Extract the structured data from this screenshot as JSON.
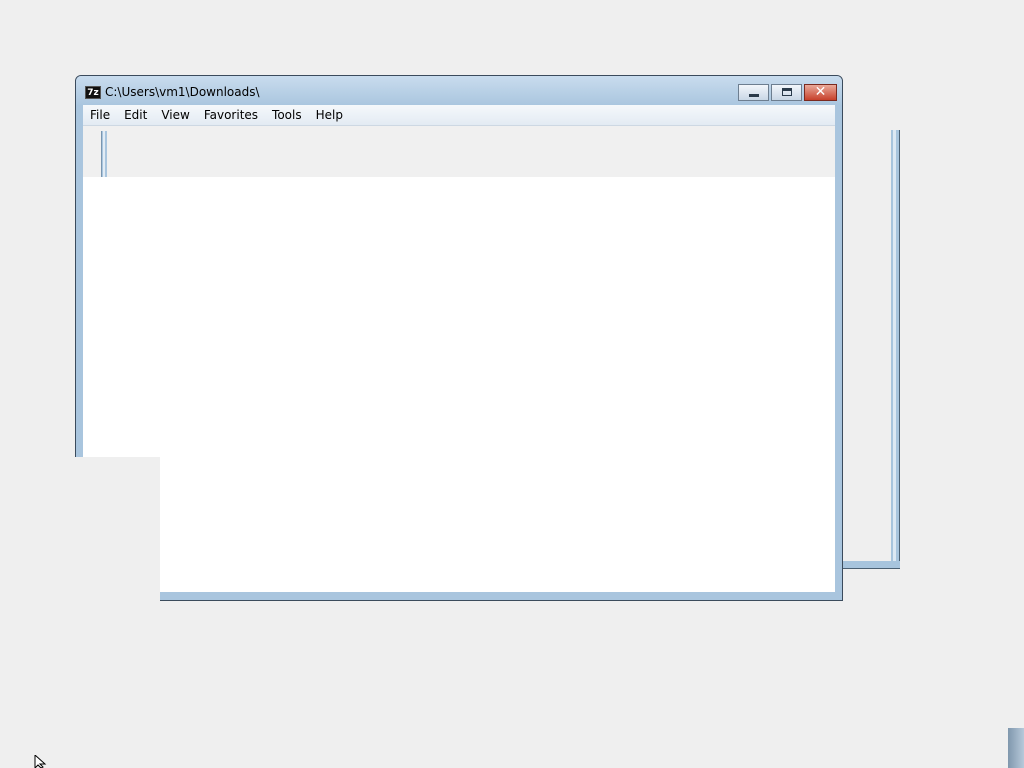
{
  "window": {
    "title": "C:\\Users\\vm1\\Downloads\\",
    "app_icon_label": "7z",
    "icon_names": {
      "app": "7zip-app-icon",
      "minimize": "minimize-icon",
      "maximize": "maximize-icon",
      "close": "close-icon",
      "cursor": "mouse-cursor-icon"
    }
  },
  "menubar": {
    "items": [
      {
        "label": "File"
      },
      {
        "label": "Edit"
      },
      {
        "label": "View"
      },
      {
        "label": "Favorites"
      },
      {
        "label": "Tools"
      },
      {
        "label": "Help"
      }
    ]
  },
  "colors": {
    "desktop": "#efefef",
    "frame": "#a9c5de",
    "close_button": "#c7402b",
    "client_background": "#ffffff"
  }
}
